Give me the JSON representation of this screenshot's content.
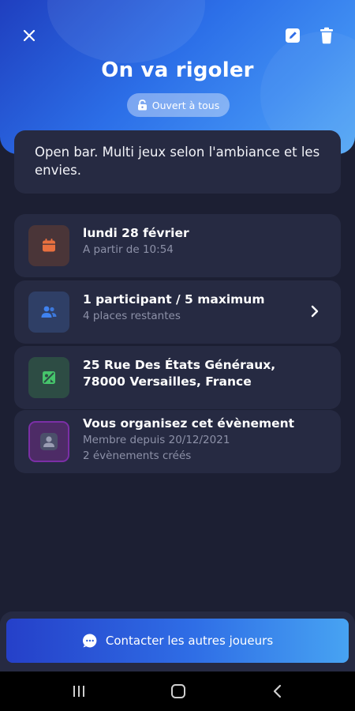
{
  "header": {
    "title": "On va rigoler",
    "badge_label": "Ouvert à tous",
    "close_icon": "close-icon",
    "edit_icon": "edit-icon",
    "delete_icon": "trash-icon"
  },
  "description": "Open bar. Multi jeux selon l'ambiance et les envies.",
  "info": {
    "date": {
      "main": "lundi 28 février",
      "sub": "A partir de 10:54",
      "icon": "calendar-icon",
      "color": "#e8703f"
    },
    "participants": {
      "main": "1 participant / 5 maximum",
      "sub": "4 places restantes",
      "icon": "users-icon",
      "color": "#3a7be8"
    },
    "location": {
      "line1": "25 Rue Des États Généraux,",
      "line2": "78000 Versailles, France",
      "icon": "map-icon",
      "color": "#3fbf63"
    },
    "organizer": {
      "main": "Vous organisez cet évènement",
      "sub1": "Membre depuis 20/12/2021",
      "sub2": "2 évènements créés",
      "icon": "user-avatar-icon",
      "color": "#8b2fb8"
    }
  },
  "contact_button": {
    "label": "Contacter les autres joueurs",
    "icon": "chat-icon"
  },
  "colors": {
    "background": "#1c1f33",
    "card": "#262a42",
    "accent": "#2f6ee6"
  }
}
